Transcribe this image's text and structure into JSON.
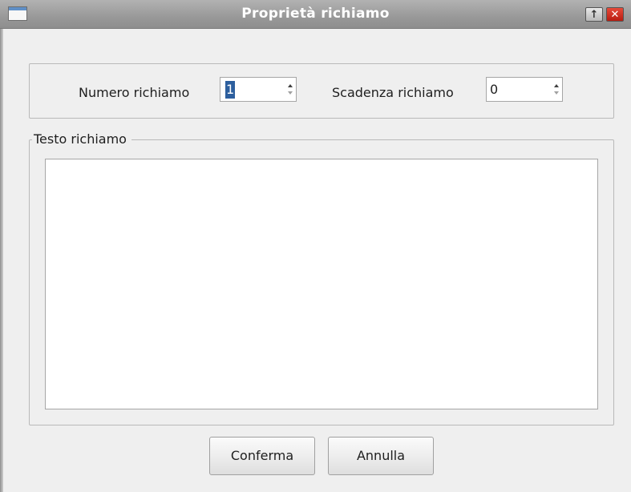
{
  "window": {
    "title": "Proprietà richiamo",
    "controls": {
      "restore_icon": "↑",
      "close_icon": "✕"
    }
  },
  "fields": {
    "numero": {
      "label": "Numero richiamo",
      "value": "1",
      "selected": true
    },
    "scadenza": {
      "label": "Scadenza richiamo",
      "value": "0"
    }
  },
  "text_group": {
    "title": "Testo richiamo",
    "value": ""
  },
  "buttons": {
    "confirm": "Conferma",
    "cancel": "Annulla"
  },
  "colors": {
    "selection": "#2d5f9e",
    "titlebar": "#999999",
    "background": "#efefef"
  }
}
